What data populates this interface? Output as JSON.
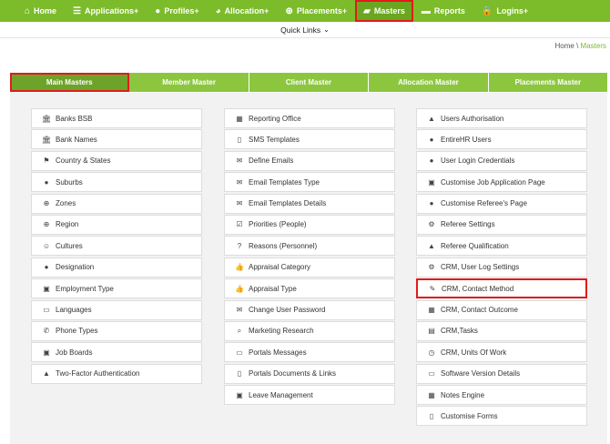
{
  "nav": [
    {
      "icon": "home-icon",
      "glyph": "⌂",
      "label": "Home",
      "highlight": false
    },
    {
      "icon": "list-icon",
      "glyph": "☰",
      "label": "Applications+",
      "highlight": false
    },
    {
      "icon": "user-icon",
      "glyph": "●",
      "label": "Profiles+",
      "highlight": false
    },
    {
      "icon": "pie-chart-icon",
      "glyph": "◕",
      "label": "Allocation+",
      "highlight": false
    },
    {
      "icon": "globe-icon",
      "glyph": "⊕",
      "label": "Placements+",
      "highlight": false
    },
    {
      "icon": "folder-open-icon",
      "glyph": "▰",
      "label": "Masters",
      "highlight": true
    },
    {
      "icon": "folder-icon",
      "glyph": "▬",
      "label": "Reports",
      "highlight": false
    },
    {
      "icon": "lock-icon",
      "glyph": "🔒",
      "label": "Logins+",
      "highlight": false
    }
  ],
  "quick_links": {
    "label": "Quick Links"
  },
  "breadcrumb": {
    "home": "Home",
    "separator": " \\ ",
    "current": "Masters"
  },
  "tabs": [
    {
      "label": "Main Masters",
      "active": true
    },
    {
      "label": "Member Master",
      "active": false
    },
    {
      "label": "Client Master",
      "active": false
    },
    {
      "label": "Allocation Master",
      "active": false
    },
    {
      "label": "Placements Master",
      "active": false
    }
  ],
  "columns": [
    [
      {
        "label": "Banks BSB",
        "icon": "bank-icon",
        "glyph": "🏛",
        "highlight": false
      },
      {
        "label": "Bank Names",
        "icon": "bank-icon",
        "glyph": "🏛",
        "highlight": false
      },
      {
        "label": "Country & States",
        "icon": "flag-icon",
        "glyph": "⚑",
        "highlight": false
      },
      {
        "label": "Suburbs",
        "icon": "map-marker-icon",
        "glyph": "●",
        "highlight": false
      },
      {
        "label": "Zones",
        "icon": "globe-icon",
        "glyph": "⊕",
        "highlight": false
      },
      {
        "label": "Region",
        "icon": "globe-icon",
        "glyph": "⊕",
        "highlight": false
      },
      {
        "label": "Cultures",
        "icon": "smile-icon",
        "glyph": "☺",
        "highlight": false
      },
      {
        "label": "Designation",
        "icon": "user-icon",
        "glyph": "●",
        "highlight": false
      },
      {
        "label": "Employment Type",
        "icon": "briefcase-icon",
        "glyph": "▣",
        "highlight": false
      },
      {
        "label": "Languages",
        "icon": "language-icon",
        "glyph": "▭",
        "highlight": false
      },
      {
        "label": "Phone Types",
        "icon": "phone-icon",
        "glyph": "✆",
        "highlight": false
      },
      {
        "label": "Job Boards",
        "icon": "briefcase-icon",
        "glyph": "▣",
        "highlight": false
      },
      {
        "label": "Two-Factor Authentication",
        "icon": "lock-icon",
        "glyph": "▲",
        "highlight": false
      }
    ],
    [
      {
        "label": "Reporting Office",
        "icon": "building-icon",
        "glyph": "▦",
        "highlight": false
      },
      {
        "label": "SMS Templates",
        "icon": "mobile-icon",
        "glyph": "▯",
        "highlight": false
      },
      {
        "label": "Define Emails",
        "icon": "envelope-icon",
        "glyph": "✉",
        "highlight": false
      },
      {
        "label": "Email Templates Type",
        "icon": "envelope-icon",
        "glyph": "✉",
        "highlight": false
      },
      {
        "label": "Email Templates Details",
        "icon": "envelope-icon",
        "glyph": "✉",
        "highlight": false
      },
      {
        "label": "Priorities (People)",
        "icon": "check-square-icon",
        "glyph": "☑",
        "highlight": false
      },
      {
        "label": "Reasons (Personnel)",
        "icon": "question-circle-icon",
        "glyph": "?",
        "highlight": false
      },
      {
        "label": "Appraisal Category",
        "icon": "thumbs-up-icon",
        "glyph": "👍",
        "highlight": false
      },
      {
        "label": "Appraisal Type",
        "icon": "thumbs-up-icon",
        "glyph": "👍",
        "highlight": false
      },
      {
        "label": "Change User Password",
        "icon": "envelope-icon",
        "glyph": "✉",
        "highlight": false
      },
      {
        "label": "Marketing Research",
        "icon": "search-icon",
        "glyph": "⌕",
        "highlight": false
      },
      {
        "label": "Portals Messages",
        "icon": "desktop-icon",
        "glyph": "▭",
        "highlight": false
      },
      {
        "label": "Portals Documents & Links",
        "icon": "file-icon",
        "glyph": "▯",
        "highlight": false
      },
      {
        "label": "Leave Management",
        "icon": "briefcase-icon",
        "glyph": "▣",
        "highlight": false
      }
    ],
    [
      {
        "label": "Users Authorisation",
        "icon": "lock-icon",
        "glyph": "▲",
        "highlight": false
      },
      {
        "label": "EntireHR Users",
        "icon": "users-icon",
        "glyph": "●",
        "highlight": false
      },
      {
        "label": "User Login Credentials",
        "icon": "user-icon",
        "glyph": "●",
        "highlight": false
      },
      {
        "label": "Customise Job Application Page",
        "icon": "briefcase-icon",
        "glyph": "▣",
        "highlight": false
      },
      {
        "label": "Customise Referee's Page",
        "icon": "user-plus-icon",
        "glyph": "●",
        "highlight": false
      },
      {
        "label": "Referee Settings",
        "icon": "cogs-icon",
        "glyph": "⚙",
        "highlight": false
      },
      {
        "label": "Referee Qualification",
        "icon": "graduation-cap-icon",
        "glyph": "▲",
        "highlight": false
      },
      {
        "label": "CRM, User Log Settings",
        "icon": "gear-icon",
        "glyph": "⚙",
        "highlight": false
      },
      {
        "label": "CRM, Contact Method",
        "icon": "paint-brush-icon",
        "glyph": "✎",
        "highlight": true
      },
      {
        "label": "CRM, Contact Outcome",
        "icon": "calendar-icon",
        "glyph": "▦",
        "highlight": false
      },
      {
        "label": "CRM,Tasks",
        "icon": "list-alt-icon",
        "glyph": "▤",
        "highlight": false
      },
      {
        "label": "CRM, Units Of Work",
        "icon": "clock-icon",
        "glyph": "◷",
        "highlight": false
      },
      {
        "label": "Software Version Details",
        "icon": "desktop-icon",
        "glyph": "▭",
        "highlight": false
      },
      {
        "label": "Notes Engine",
        "icon": "th-large-icon",
        "glyph": "▦",
        "highlight": false
      },
      {
        "label": "Customise Forms",
        "icon": "file-icon",
        "glyph": "▯",
        "highlight": false
      }
    ]
  ]
}
